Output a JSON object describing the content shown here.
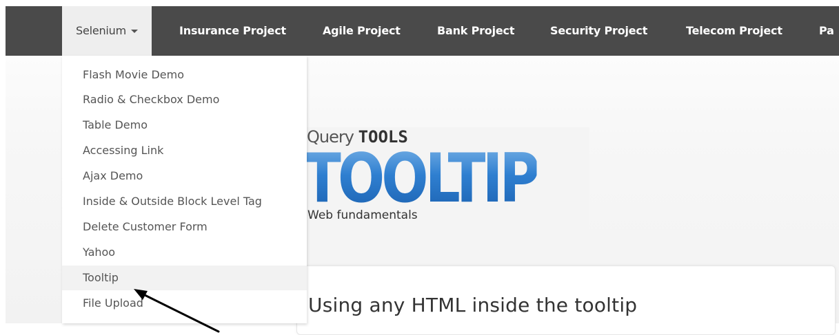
{
  "navbar": {
    "items": [
      {
        "label": "Selenium",
        "active": true
      },
      {
        "label": "Insurance Project"
      },
      {
        "label": "Agile Project"
      },
      {
        "label": "Bank Project"
      },
      {
        "label": "Security Project"
      },
      {
        "label": "Telecom Project"
      },
      {
        "label": "Pa"
      }
    ]
  },
  "dropdown": {
    "items": [
      "Flash Movie Demo",
      "Radio & Checkbox Demo",
      "Table Demo",
      "Accessing Link",
      "Ajax Demo",
      "Inside & Outside Block Level Tag",
      "Delete Customer Form",
      "Yahoo",
      "Tooltip",
      "File Upload"
    ],
    "highlighted": "Tooltip"
  },
  "hero": {
    "query_prefix": "Query",
    "query_tools": "TOOLS",
    "title": "TOOLTIP",
    "subtitle": "Web fundamentals"
  },
  "content": {
    "heading": "Using any HTML inside the tooltip"
  },
  "icons": {
    "caret": "chevron-down-icon",
    "pointer": "annotation-arrow-icon"
  },
  "colors": {
    "navbar_bg": "#4a4a4a",
    "active_tab_bg": "#eeeeee",
    "dropdown_hover_bg": "#f2f2f2",
    "tooltip_blue": "#2f7fd0"
  }
}
